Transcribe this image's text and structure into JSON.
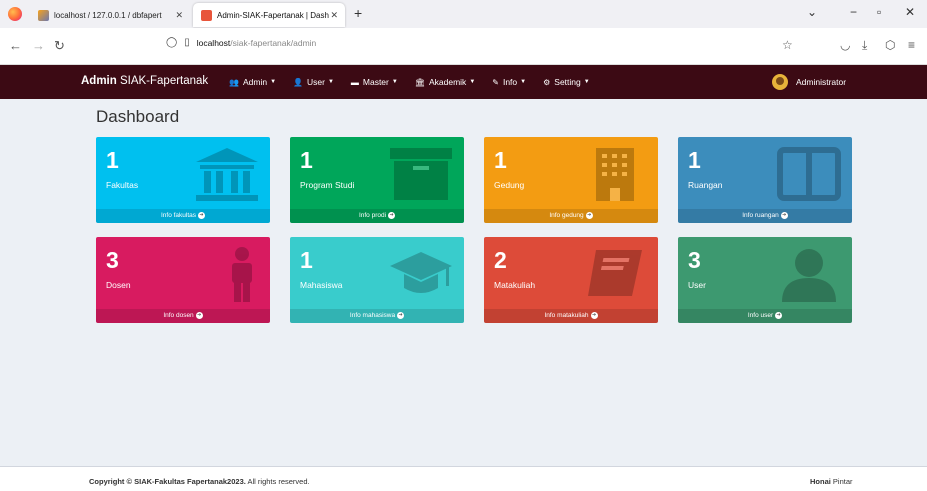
{
  "browser": {
    "tabs": [
      {
        "label": "localhost / 127.0.0.1 / dbfapert",
        "icon": "phpmyadmin-icon"
      },
      {
        "label": "Admin-SIAK-Fapertanak | Dash",
        "icon": "page-icon"
      }
    ],
    "new_tab": "+",
    "url_host": "localhost",
    "url_path": "/siak-fapertanak/admin"
  },
  "app": {
    "brand_bold": "Admin",
    "brand_rest": " SIAK-Fapertanak",
    "menu": [
      {
        "label": "Admin",
        "icon": "users-icon",
        "glyph": "👥"
      },
      {
        "label": "User",
        "icon": "user-icon",
        "glyph": "👤"
      },
      {
        "label": "Master",
        "icon": "folder-icon",
        "glyph": "▬"
      },
      {
        "label": "Akademik",
        "icon": "bank-icon",
        "glyph": "🏛"
      },
      {
        "label": "Info",
        "icon": "edit-icon",
        "glyph": "✎"
      },
      {
        "label": "Setting",
        "icon": "gear-icon",
        "glyph": "⚙"
      }
    ],
    "user_name": "Administrator"
  },
  "page_title": "Dashboard",
  "boxes": [
    {
      "num": "1",
      "label": "Fakultas",
      "link": "Info fakultas",
      "color": "#00c0ef",
      "icon": "bank-icon"
    },
    {
      "num": "1",
      "label": "Program Studi",
      "link": "Info prodi",
      "color": "#00a65a",
      "icon": "archive-icon"
    },
    {
      "num": "1",
      "label": "Gedung",
      "link": "Info gedung",
      "color": "#f39c12",
      "icon": "building-icon"
    },
    {
      "num": "1",
      "label": "Ruangan",
      "link": "Info ruangan",
      "color": "#3c8dbc",
      "icon": "columns-icon"
    },
    {
      "num": "3",
      "label": "Dosen",
      "link": "Info dosen",
      "color": "#d81b60",
      "icon": "male-icon"
    },
    {
      "num": "1",
      "label": "Mahasiswa",
      "link": "Info mahasiswa",
      "color": "#39cccc",
      "icon": "graduation-cap-icon"
    },
    {
      "num": "2",
      "label": "Matakuliah",
      "link": "Info matakuliah",
      "color": "#dd4b39",
      "icon": "book-icon"
    },
    {
      "num": "3",
      "label": "User",
      "link": "Info user",
      "color": "#3d9970",
      "icon": "user-icon"
    }
  ],
  "footer": {
    "copy_bold": "Copyright © SIAK-Fakultas Fapertanak2023.",
    "copy_rest": " All rights reserved.",
    "right_bold": "Honai",
    "right_rest": " Pintar"
  }
}
